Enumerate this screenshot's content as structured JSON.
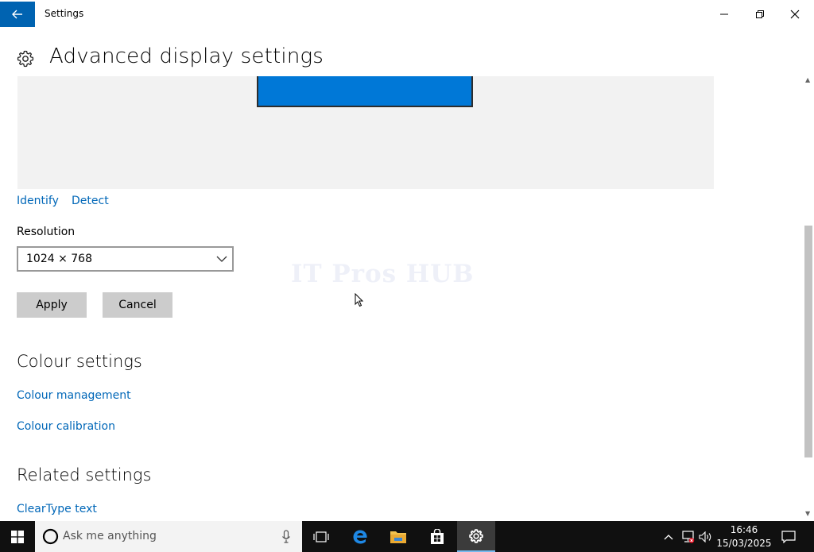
{
  "window": {
    "title": "Settings"
  },
  "header": {
    "title": "Advanced display settings"
  },
  "display_links": {
    "identify": "Identify",
    "detect": "Detect"
  },
  "resolution": {
    "label": "Resolution",
    "value": "1024 × 768"
  },
  "buttons": {
    "apply": "Apply",
    "cancel": "Cancel"
  },
  "colour_settings": {
    "heading": "Colour settings",
    "management": "Colour management",
    "calibration": "Colour calibration"
  },
  "related_settings": {
    "heading": "Related settings",
    "cleartype": "ClearType text"
  },
  "watermark": "IT Pros HUB",
  "taskbar": {
    "search_placeholder": "Ask me anything",
    "time": "16:46",
    "date": "15/03/2025"
  },
  "colors": {
    "accent": "#0063b1",
    "link": "#0067b8",
    "monitor": "#0078d7",
    "taskbar": "#101010"
  },
  "icons": [
    "back-arrow-icon",
    "minimize-icon",
    "restore-icon",
    "close-icon",
    "gear-icon",
    "chevron-down-icon",
    "windows-start-icon",
    "cortana-icon",
    "microphone-icon",
    "task-view-icon",
    "edge-icon",
    "file-explorer-icon",
    "store-icon",
    "settings-icon",
    "chevron-up-icon",
    "network-icon",
    "volume-icon",
    "action-center-icon"
  ]
}
